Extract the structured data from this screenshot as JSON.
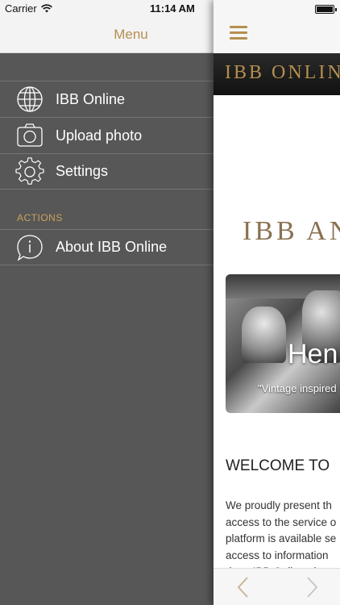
{
  "status": {
    "carrier": "Carrier",
    "time": "11:14 AM"
  },
  "drawer": {
    "title": "Menu",
    "items": [
      {
        "label": "IBB Online",
        "icon": "globe-icon"
      },
      {
        "label": "Upload photo",
        "icon": "camera-icon"
      },
      {
        "label": "Settings",
        "icon": "gear-icon"
      }
    ],
    "section_label": "ACTIONS",
    "actions": [
      {
        "label": "About IBB Online",
        "icon": "info-icon"
      }
    ]
  },
  "content": {
    "banner": "IBB ONLIN",
    "logo": "IBB AN",
    "hero_title": "Hen",
    "hero_subtitle": "\"Vintage inspired",
    "welcome_heading": "WELCOME TO",
    "body_lines": [
      "We proudly present th",
      "access to the service o",
      "platform is available se",
      "access to information",
      "date. IBB Online also"
    ]
  },
  "colors": {
    "accent": "#b58f4f",
    "drawer_bg": "#575757"
  }
}
